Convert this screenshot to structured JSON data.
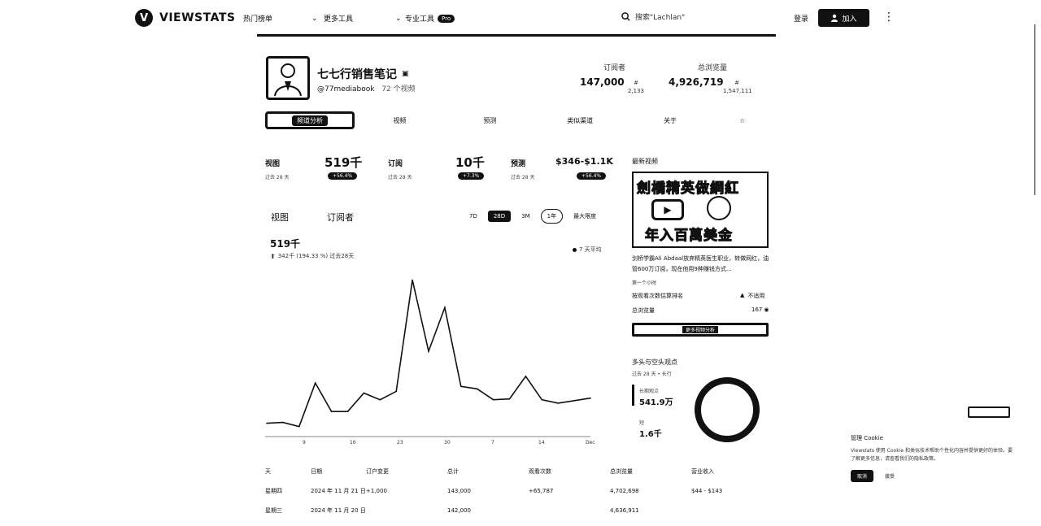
{
  "nav": {
    "logo": "VIEWSTATS",
    "hot": "热门榜单",
    "tools": "更多工具",
    "pro": "专业工具",
    "pro_badge": "Pro",
    "search_placeholder": "搜索\"Lachlan\"",
    "login": "登录",
    "join": "加入"
  },
  "channel": {
    "name": "七七行销售笔记",
    "handle": "@77mediabook",
    "video_count": "72 个视频",
    "subs_label": "订阅者",
    "subs_value": "147,000",
    "subs_rank_symbol": "#",
    "subs_rank": "2,133",
    "views_label": "总浏览量",
    "views_value": "4,926,719",
    "views_rank_symbol": "#",
    "views_rank": "1,547,111"
  },
  "tabs": [
    "频道分析",
    "视频",
    "预测",
    "类似渠道",
    "关于"
  ],
  "kpis": {
    "views_label": "视图",
    "views_value": "519千",
    "views_sub": "过去 28 天",
    "views_badge": "+56.4%",
    "subs_label": "订阅",
    "subs_value": "10千",
    "subs_sub": "过去 28 天",
    "subs_badge": "+7.3%",
    "rev_label": "预测",
    "rev_value": "$346-$1.1K",
    "rev_sub": "过去 28 天",
    "rev_badge": "+56.4%"
  },
  "chart_tabs": {
    "views": "视图",
    "subs": "订阅者"
  },
  "ranges": [
    "7D",
    "28D",
    "3M",
    "1年",
    "最大限度"
  ],
  "chart_header": {
    "value": "519千",
    "change": "342千 (194.33 %) 过去28天",
    "legend": "7 天平均"
  },
  "chart_data": {
    "type": "line",
    "series": [
      {
        "values": [
          14,
          15,
          10,
          62,
          28,
          28,
          50,
          42,
          52,
          185,
          100,
          152,
          58,
          55,
          42,
          43,
          70,
          42,
          38,
          41,
          44
        ]
      }
    ],
    "x_ticks": [
      "9",
      "16",
      "23",
      "30",
      "7",
      "14",
      "Dec"
    ],
    "ylim": [
      0,
      200
    ]
  },
  "latest": {
    "title": "最新视频",
    "thumb_top": "劍橋精英做網紅",
    "thumb_bottom": "年入百萬美金",
    "desc": "剑桥学霸Ali Abdaal放弃精英医生职业，转做网红，油管600万订阅，现在他用9种赚钱方式…",
    "age": "第一个小时",
    "rank_label": "按观看次数估算排名",
    "rank_value": "不适用",
    "views_label": "总浏览量",
    "views_value": "167",
    "button": "更多视频分析"
  },
  "long_short": {
    "title": "多头与空头观点",
    "sub": "过去 28 天 • 长行",
    "long_label": "长期观点",
    "long_value": "541.9万",
    "short_label": "短",
    "short_value": "1.6千"
  },
  "table": {
    "headers": [
      "天",
      "日期",
      "订户变更",
      "总计",
      "观看次数",
      "总浏览量",
      "营业收入"
    ],
    "rows": [
      [
        "星期四",
        "2024 年 11 月 21 日",
        "+1,000",
        "143,000",
        "+65,787",
        "4,702,698",
        "$44 - $143"
      ],
      [
        "星期三",
        "2024 年 11 月 20 日",
        "",
        "142,000",
        "",
        "4,636,911",
        ""
      ]
    ]
  },
  "cookie": {
    "title": "管理 Cookie",
    "text": "Viewstats 使用 Cookie 和类似技术帮助个性化内容并提供更好的体验。要了解更多信息，请查看我们的隐私政策。",
    "accept": "取消",
    "decline": "接受"
  }
}
